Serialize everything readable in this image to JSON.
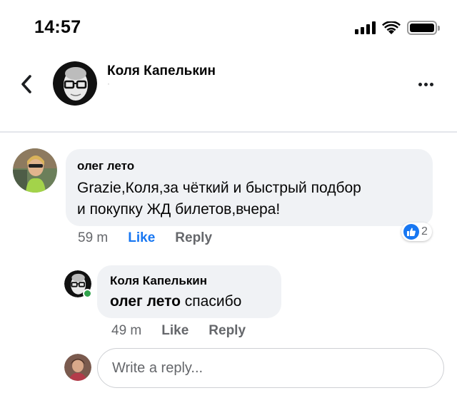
{
  "status_bar": {
    "time": "14:57",
    "icons": [
      "signal-icon",
      "wifi-icon",
      "battery-icon"
    ]
  },
  "header": {
    "title": "Коля Капелькин",
    "subtitle": "·",
    "back_icon": "chevron-left-icon",
    "more_icon": "more-horizontal-icon"
  },
  "comments": [
    {
      "author": "олег лето",
      "text": "Grazie,Коля,за чёткий и быстрый подбор и покупку ЖД билетов,вчера!",
      "text_line1": "Grazie,Коля,за чёткий и быстрый подбор",
      "text_line2": "и покупку ЖД билетов,вчера!",
      "time": "59 m",
      "like_label": "Like",
      "reply_label": "Reply",
      "reaction_icon": "thumbs-up-icon",
      "reaction_count": "2"
    }
  ],
  "replies": [
    {
      "author": "Коля Капелькин",
      "mention": "олег лето",
      "text": "спасибо",
      "time": "49 m",
      "like_label": "Like",
      "reply_label": "Reply"
    }
  ],
  "reply_input": {
    "placeholder": "Write a reply..."
  },
  "colors": {
    "accent": "#1877f2",
    "bubble": "#f0f2f5",
    "secondary_text": "#65676b",
    "online": "#31a24c"
  }
}
